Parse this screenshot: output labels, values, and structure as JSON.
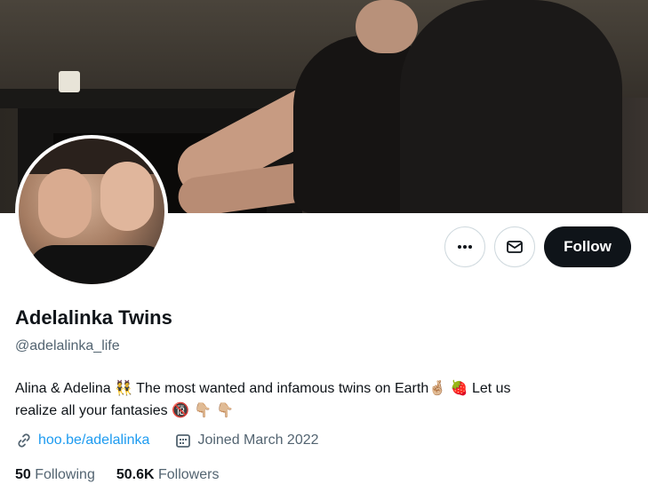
{
  "profile": {
    "display_name": "Adelalinka Twins",
    "handle": "@adelalinka_life",
    "bio_line1_a": "Alina & Adelina ",
    "bio_emoji_twins": "👯",
    "bio_line1_b": " The most wanted and infamous twins on Earth",
    "bio_emoji_fingers": "🤞🏼",
    "bio_emoji_strawberry": "🍓",
    "bio_line1_c": " Let us",
    "bio_line2": "realize all your fantasies ",
    "bio_emoji_18": "🔞",
    "bio_emoji_point": " 👇🏼 👇🏼",
    "link_text": "hoo.be/adelalinka",
    "joined": "Joined March 2022",
    "following_count": "50",
    "following_label": "Following",
    "followers_count": "50.6K",
    "followers_label": "Followers"
  },
  "actions": {
    "more_icon": "more-horizontal-icon",
    "message_icon": "envelope-icon",
    "follow_label": "Follow"
  },
  "colors": {
    "accent_link": "#1d9bf0",
    "follow_bg": "#0f1419",
    "secondary_text": "#536471"
  }
}
